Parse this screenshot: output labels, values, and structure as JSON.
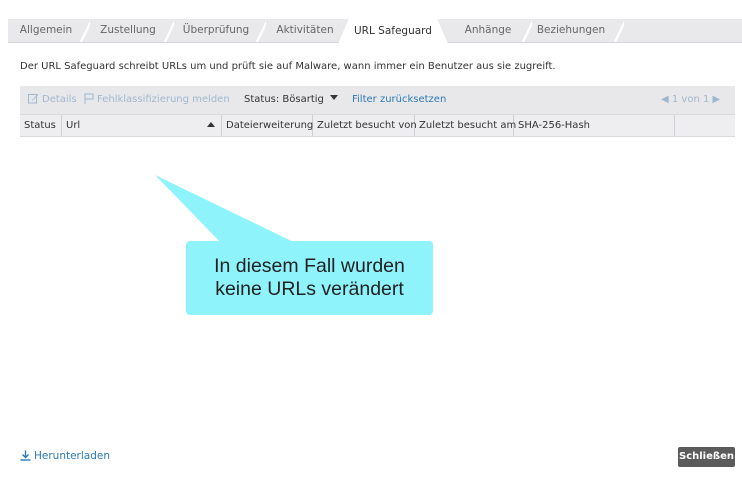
{
  "tabs": [
    {
      "label": "Allgemein",
      "active": false
    },
    {
      "label": "Zustellung",
      "active": false
    },
    {
      "label": "Überprüfung",
      "active": false
    },
    {
      "label": "Aktivitäten",
      "active": false
    },
    {
      "label": "URL Safeguard",
      "active": true
    },
    {
      "label": "Anhänge",
      "active": false
    },
    {
      "label": "Beziehungen",
      "active": false
    }
  ],
  "description": "Der URL Safeguard schreibt URLs um und prüft sie auf Malware, wann immer ein Benutzer aus sie zugreift.",
  "toolbar": {
    "details_label": "Details",
    "misclassify_label": "Fehlklassifizierung melden",
    "status_filter_label": "Status: Bösartig",
    "reset_filter_label": "Filter zurücksetzen",
    "pager_label": "1 von 1"
  },
  "table": {
    "columns": [
      "Status",
      "Url",
      "Dateierweiterung",
      "Zuletzt besucht von",
      "Zuletzt besucht am",
      "SHA-256-Hash"
    ],
    "rows": []
  },
  "callout": {
    "line1": "In diesem Fall wurden",
    "line2": "keine URLs verändert"
  },
  "footer": {
    "download_label": "Herunterladen",
    "close_label": "Schließen"
  },
  "colors": {
    "link": "#2a7ab8",
    "callout": "#8ef3fb",
    "close_button": "#5b5b5b"
  }
}
